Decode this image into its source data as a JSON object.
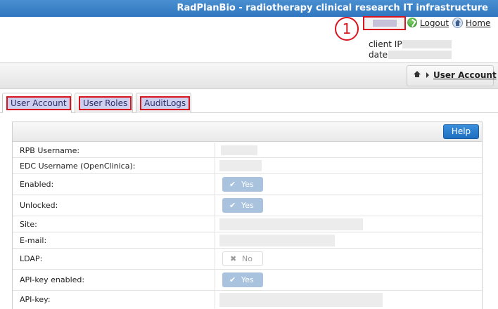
{
  "header": {
    "title": "RadPlanBio - radiotherapy clinical research IT infrastructure"
  },
  "top_links": {
    "logout": "Logout",
    "home": "Home"
  },
  "callout": {
    "number": "1"
  },
  "session": {
    "client_ip_label": "client IP:",
    "date_label": "date:"
  },
  "breadcrumb": {
    "current": "User Account"
  },
  "tabs": [
    {
      "label": "User Account"
    },
    {
      "label": "User Roles"
    },
    {
      "label": "AuditLogs"
    }
  ],
  "panel": {
    "help_label": "Help"
  },
  "fields": {
    "rpb_username": {
      "label": "RPB Username:"
    },
    "edc_username": {
      "label": "EDC Username (OpenClinica):"
    },
    "enabled": {
      "label": "Enabled:",
      "value": "Yes"
    },
    "unlocked": {
      "label": "Unlocked:",
      "value": "Yes"
    },
    "site": {
      "label": "Site:"
    },
    "email": {
      "label": "E-mail:"
    },
    "ldap": {
      "label": "LDAP:",
      "value": "No"
    },
    "api_key_enabled": {
      "label": "API-key enabled:",
      "value": "Yes"
    },
    "api_key": {
      "label": "API-key:"
    }
  },
  "icons": {
    "check": "✔",
    "cross": "✖"
  },
  "colors": {
    "accent_blue": "#2f77c0",
    "highlight_red": "#d8141f",
    "toggle_yes": "#a9c3de"
  }
}
